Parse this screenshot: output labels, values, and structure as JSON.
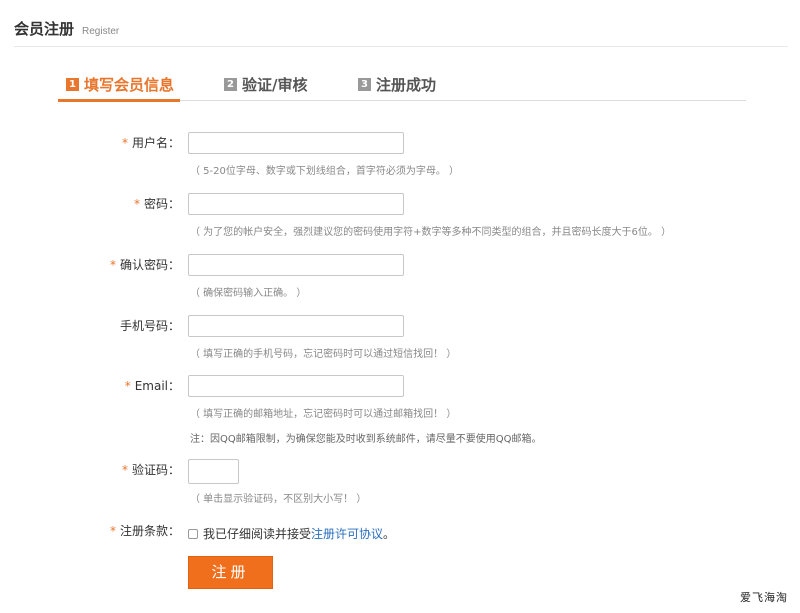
{
  "header": {
    "title": "会员注册",
    "subtitle": "Register"
  },
  "steps": [
    {
      "num": "1",
      "label": "填写会员信息",
      "active": true
    },
    {
      "num": "2",
      "label": "验证/审核",
      "active": false
    },
    {
      "num": "3",
      "label": "注册成功",
      "active": false
    }
  ],
  "form": {
    "username": {
      "required_mark": "*",
      "label": "用户名：",
      "value": "",
      "hint": "（ 5-20位字母、数字或下划线组合，首字符必须为字母。 ）"
    },
    "password": {
      "required_mark": "*",
      "label": "密码：",
      "value": "",
      "hint": "（ 为了您的帐户安全，强烈建议您的密码使用字符+数字等多种不同类型的组合，并且密码长度大于6位。 ）"
    },
    "confirm_password": {
      "required_mark": "*",
      "label": "确认密码：",
      "value": "",
      "hint": "（ 确保密码输入正确。 ）"
    },
    "phone": {
      "label": "手机号码：",
      "value": "",
      "hint": "（ 填写正确的手机号码，忘记密码时可以通过短信找回！ ）"
    },
    "email": {
      "required_mark": "*",
      "label": "Email：",
      "value": "",
      "hint": "（ 填写正确的邮箱地址，忘记密码时可以通过邮箱找回！ ）",
      "note": "注：因QQ邮箱限制，为确保您能及时收到系统邮件，请尽量不要使用QQ邮箱。"
    },
    "captcha": {
      "required_mark": "*",
      "label": "验证码：",
      "value": "",
      "hint": "（ 单击显示验证码，不区别大小写！ ）"
    },
    "terms": {
      "required_mark": "*",
      "label": "注册条款：",
      "agree_text": "我已仔细阅读并接受",
      "link_text": "注册许可协议",
      "suffix": "。",
      "checked": false
    },
    "submit_label": "注册"
  },
  "watermark": "爱飞海淘",
  "colors": {
    "accent": "#e8762d",
    "button": "#f06f1c",
    "link": "#2a6fbf",
    "inactive_step": "#999999"
  }
}
